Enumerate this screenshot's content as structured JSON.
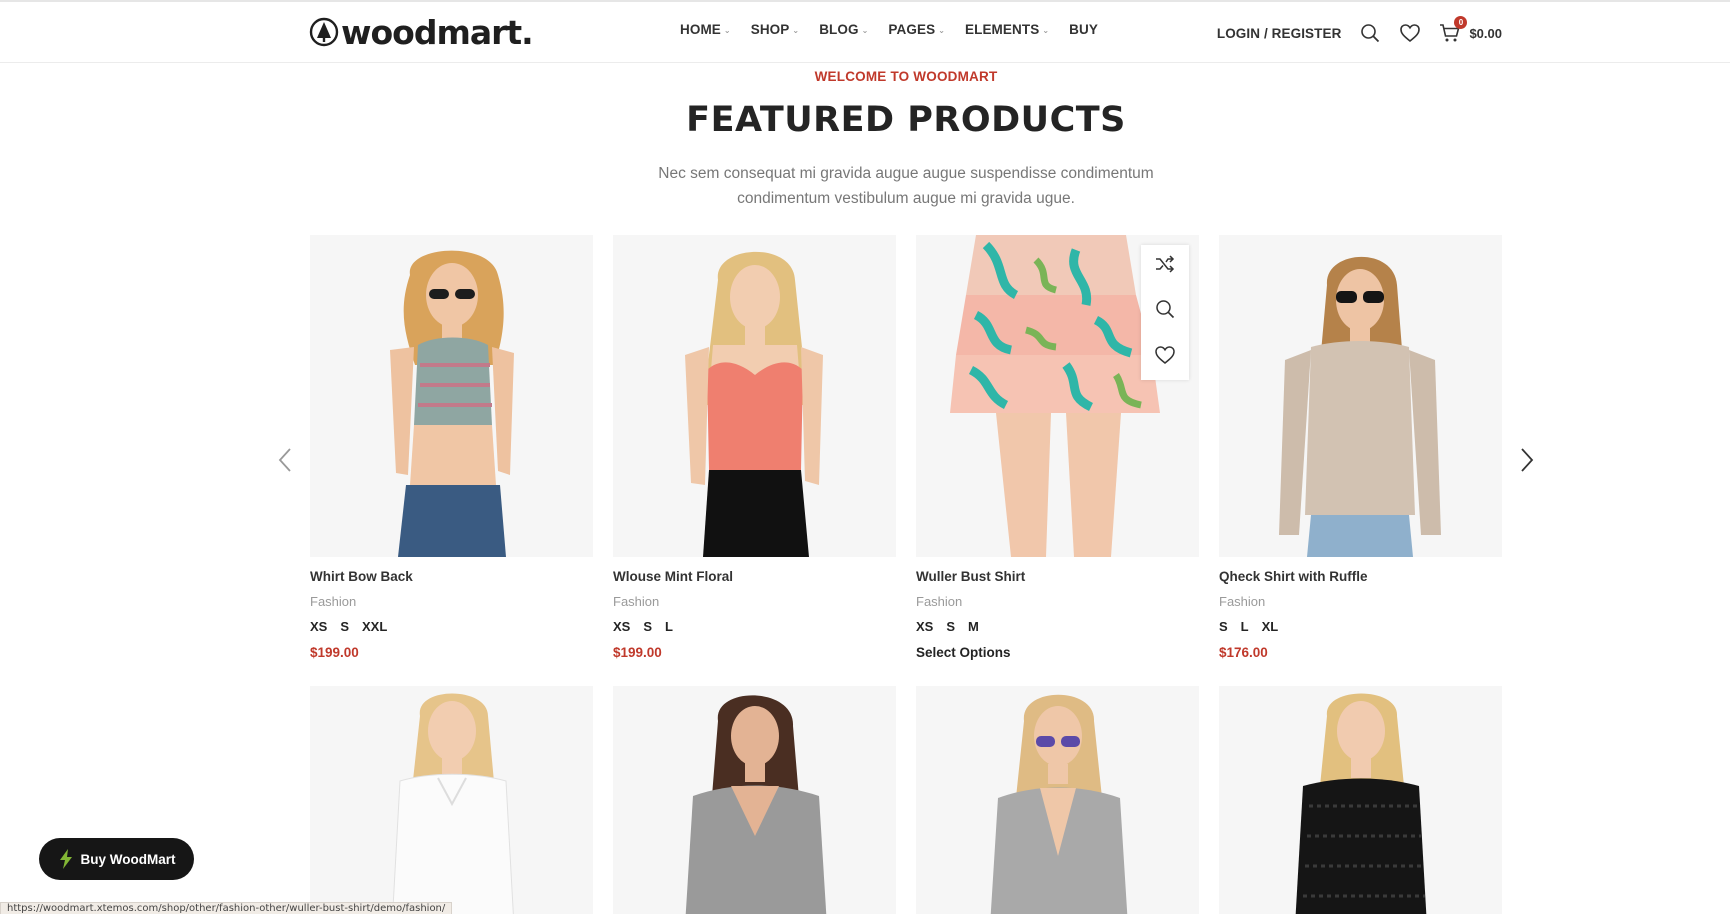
{
  "header": {
    "logo_text": "woodmart.",
    "nav": [
      {
        "label": "HOME",
        "has_caret": true
      },
      {
        "label": "SHOP",
        "has_caret": true
      },
      {
        "label": "BLOG",
        "has_caret": true
      },
      {
        "label": "PAGES",
        "has_caret": true
      },
      {
        "label": "ELEMENTS",
        "has_caret": true
      },
      {
        "label": "BUY",
        "has_caret": false
      }
    ],
    "login_label": "LOGIN / REGISTER",
    "cart_count": "0",
    "cart_total": "$0.00"
  },
  "section": {
    "subtitle": "WELCOME TO WOODMART",
    "title": "FEATURED PRODUCTS",
    "description": "Nec sem consequat mi gravida augue augue suspendisse condimentum condimentum vestibulum augue mi gravida ugue."
  },
  "products": [
    {
      "name": "Whirt Bow Back",
      "category": "Fashion",
      "sizes": [
        "XS",
        "S",
        "XXL"
      ],
      "price": "$199.00"
    },
    {
      "name": "Wlouse Mint Floral",
      "category": "Fashion",
      "sizes": [
        "XS",
        "S",
        "L"
      ],
      "price": "$199.00"
    },
    {
      "name": "Wuller Bust Shirt",
      "category": "Fashion",
      "sizes": [
        "XS",
        "S",
        "M"
      ],
      "price": "Select Options"
    },
    {
      "name": "Qheck Shirt with Ruffle",
      "category": "Fashion",
      "sizes": [
        "S",
        "L",
        "XL"
      ],
      "price": "$176.00"
    }
  ],
  "buy_button_label": "Buy WoodMart",
  "status_url": "https://woodmart.xtemos.com/shop/other/fashion-other/wuller-bust-shirt/demo/fashion/",
  "colors": {
    "accent": "#c0392b",
    "text": "#242424",
    "muted": "#9a9a9a",
    "button": "#161616",
    "bolt": "#83b735"
  }
}
